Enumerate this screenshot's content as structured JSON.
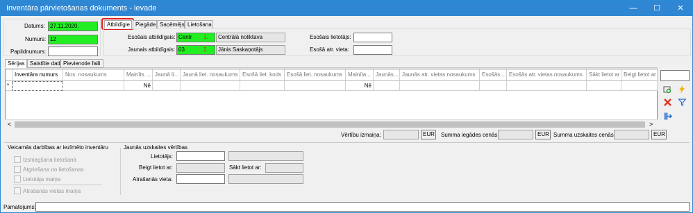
{
  "window": {
    "title": "Inventāra pārvietošanas dokuments - ievade",
    "minimize_glyph": "—",
    "maximize_glyph": "☐",
    "close_glyph": "✕"
  },
  "header": {
    "date_label": "Datums:",
    "date_value": "27.11.2020.",
    "number_label": "Numurs:",
    "number_value": "12",
    "extra_number_label": "Papildnumurs:",
    "extra_number_value": ""
  },
  "top_tabs": [
    "Atbildīgie",
    "Piegāde",
    "Saņēmējs",
    "Lietošana"
  ],
  "responsible": {
    "old_label": "Esošais atbildīgais:",
    "old_code": "Centr",
    "old_marker": "1.",
    "old_name": "Centrālā noliktava",
    "new_label": "Jaunais atbildīgais:",
    "new_code": "03",
    "new_marker": "2.",
    "new_name": "Jānis Saskaņotājs",
    "old_user_label": "Esošais lietotājs:",
    "old_user_value": "",
    "old_location_label": "Esošā atr. vieta:",
    "old_location_value": ""
  },
  "lower_tabs": [
    "Sērijas",
    "Saistītie dati",
    "Pievienotie faili"
  ],
  "grid": {
    "columns": [
      "Inventāra numurs",
      "Nos. nosaukums",
      "Mainīts ...",
      "Jaunā li...",
      "Jaunā liet. nosaukums",
      "Esošā liet. kods",
      "Esošā liet. nosaukums",
      "Mainīta...",
      "Jaunās...",
      "Jaunās atr. vietas nosaukums",
      "Esošās ...",
      "Esošās atr. vietas nosaukums",
      "Sākt lietot ar",
      "Beigt lietot ar"
    ],
    "new_row_marker": "*",
    "row": [
      "",
      "",
      "Nē",
      "",
      "",
      "",
      "",
      "Nē",
      "",
      "",
      "",
      "",
      "",
      ""
    ],
    "scroll_left": "<",
    "scroll_right": ">"
  },
  "totals": {
    "value_change_label": "Vērtību izmaiņa:",
    "value_change": "",
    "purchase_sum_label": "Summa iegādes cenās:",
    "purchase_sum": "",
    "accounting_sum_label": "Summa uzskaites cenās:",
    "accounting_sum": "",
    "currency": "EUR"
  },
  "actions": {
    "title": "Veicamās darbības ar iezīmēto inventāru",
    "items": [
      "Izsniegšana lietošanā",
      "Atgriešana no lietošanas",
      "Lietotāja maiņa",
      "Atrašanās vietas maiņa"
    ]
  },
  "new_values": {
    "title": "Jaunās uzskaites vērtības",
    "user_label": "Lietotājs:",
    "end_use_label": "Beigt lietot ar:",
    "start_use_label": "Sākt lietot ar:",
    "location_label": "Atrašanās vieta:"
  },
  "footer": {
    "basis_label": "Pamatojums:",
    "basis_value": ""
  },
  "icons": [
    "add-row-icon",
    "lightning-icon",
    "delete-icon",
    "filter-icon",
    "import-icon"
  ],
  "colors": {
    "titlebar": "#2f87d3",
    "required_field": "#22ee22",
    "highlight_ring": "#e02020"
  }
}
